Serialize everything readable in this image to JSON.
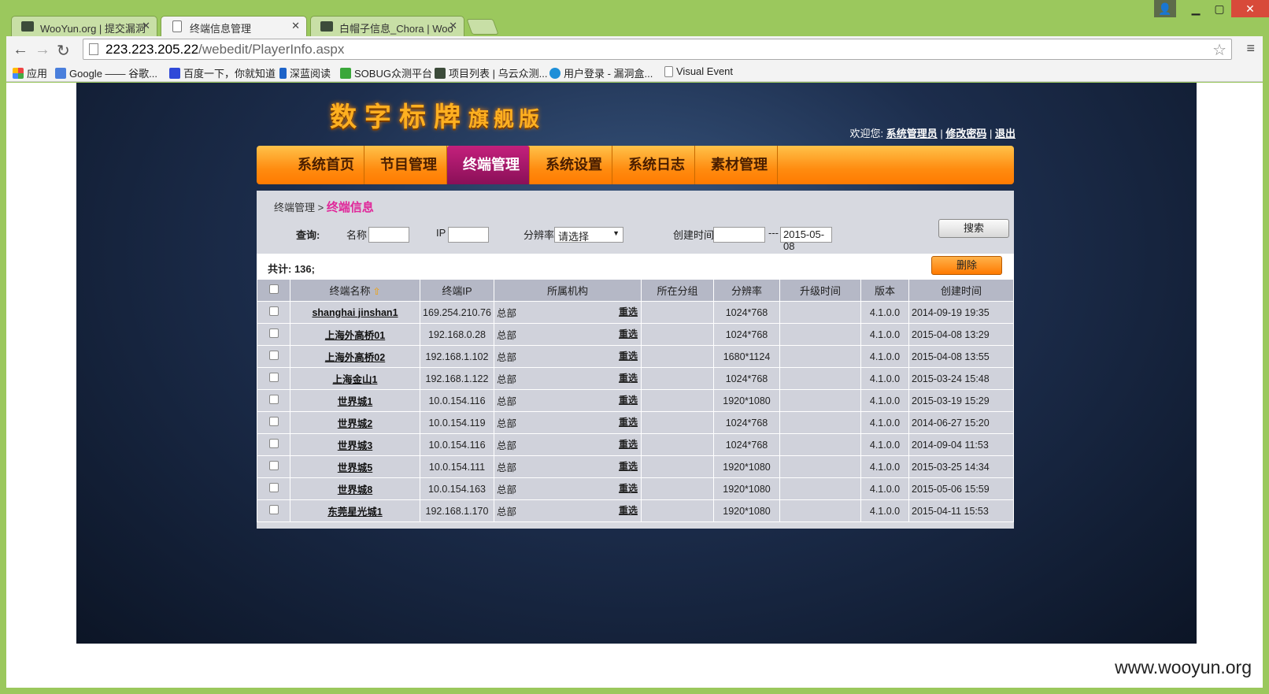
{
  "browser": {
    "tabs": [
      {
        "title": "WooYun.org | 提交漏洞",
        "favicon": "wooyun-icon"
      },
      {
        "title": "终端信息管理",
        "favicon": "page-icon"
      },
      {
        "title": "白帽子信息_Chora | Woo",
        "favicon": "wooyun-icon"
      }
    ],
    "url_host": "223.223.205.22",
    "url_path": "/webedit/PlayerInfo.aspx",
    "bookmarks": [
      "应用",
      "Google —— 谷歌...",
      "百度一下，你就知道",
      "深蓝阅读",
      "SOBUG众测平台",
      "项目列表 | 乌云众测...",
      "用户登录 - 漏洞盒...",
      "Visual Event"
    ]
  },
  "site": {
    "logo_main": "数字标牌",
    "logo_sub": "旗舰版",
    "welcome": "欢迎您:",
    "user": "系统管理员",
    "change_pwd": "修改密码",
    "logout": "退出",
    "nav": [
      "系统首页",
      "节目管理",
      "终端管理",
      "系统设置",
      "系统日志",
      "素材管理"
    ],
    "active_nav": "终端管理"
  },
  "breadcrumb": {
    "parent": "终端管理",
    "sep": ">",
    "current": "终端信息"
  },
  "query": {
    "label": "查询:",
    "name_label": "名称",
    "ip_label": "IP",
    "res_label": "分辨率",
    "res_value": "请选择",
    "created_label": "创建时间",
    "date_sep": "---",
    "date_to": "2015-05-08",
    "search_btn": "搜索"
  },
  "summary": {
    "count_text": "共计: 136;",
    "delete_btn": "删除"
  },
  "table": {
    "headers": [
      "终端名称",
      "终端IP",
      "所属机构",
      "所在分组",
      "分辨率",
      "升级时间",
      "版本",
      "创建时间"
    ],
    "reselect": "重选",
    "rows": [
      [
        "shanghai jinshan1",
        "169.254.210.76",
        "总部",
        "",
        "1024*768",
        "",
        "4.1.0.0",
        "2014-09-19 19:35"
      ],
      [
        "上海外高桥01",
        "192.168.0.28",
        "总部",
        "",
        "1024*768",
        "",
        "4.1.0.0",
        "2015-04-08 13:29"
      ],
      [
        "上海外高桥02",
        "192.168.1.102",
        "总部",
        "",
        "1680*1124",
        "",
        "4.1.0.0",
        "2015-04-08 13:55"
      ],
      [
        "上海金山1",
        "192.168.1.122",
        "总部",
        "",
        "1024*768",
        "",
        "4.1.0.0",
        "2015-03-24 15:48"
      ],
      [
        "世界城1",
        "10.0.154.116",
        "总部",
        "",
        "1920*1080",
        "",
        "4.1.0.0",
        "2015-03-19 15:29"
      ],
      [
        "世界城2",
        "10.0.154.119",
        "总部",
        "",
        "1024*768",
        "",
        "4.1.0.0",
        "2014-06-27 15:20"
      ],
      [
        "世界城3",
        "10.0.154.116",
        "总部",
        "",
        "1024*768",
        "",
        "4.1.0.0",
        "2014-09-04 11:53"
      ],
      [
        "世界城5",
        "10.0.154.111",
        "总部",
        "",
        "1920*1080",
        "",
        "4.1.0.0",
        "2015-03-25 14:34"
      ],
      [
        "世界城8",
        "10.0.154.163",
        "总部",
        "",
        "1920*1080",
        "",
        "4.1.0.0",
        "2015-05-06 15:59"
      ],
      [
        "东莞星光城1",
        "192.168.1.170",
        "总部",
        "",
        "1920*1080",
        "",
        "4.1.0.0",
        "2015-04-11 15:53"
      ]
    ]
  },
  "watermark": "www.wooyun.org"
}
